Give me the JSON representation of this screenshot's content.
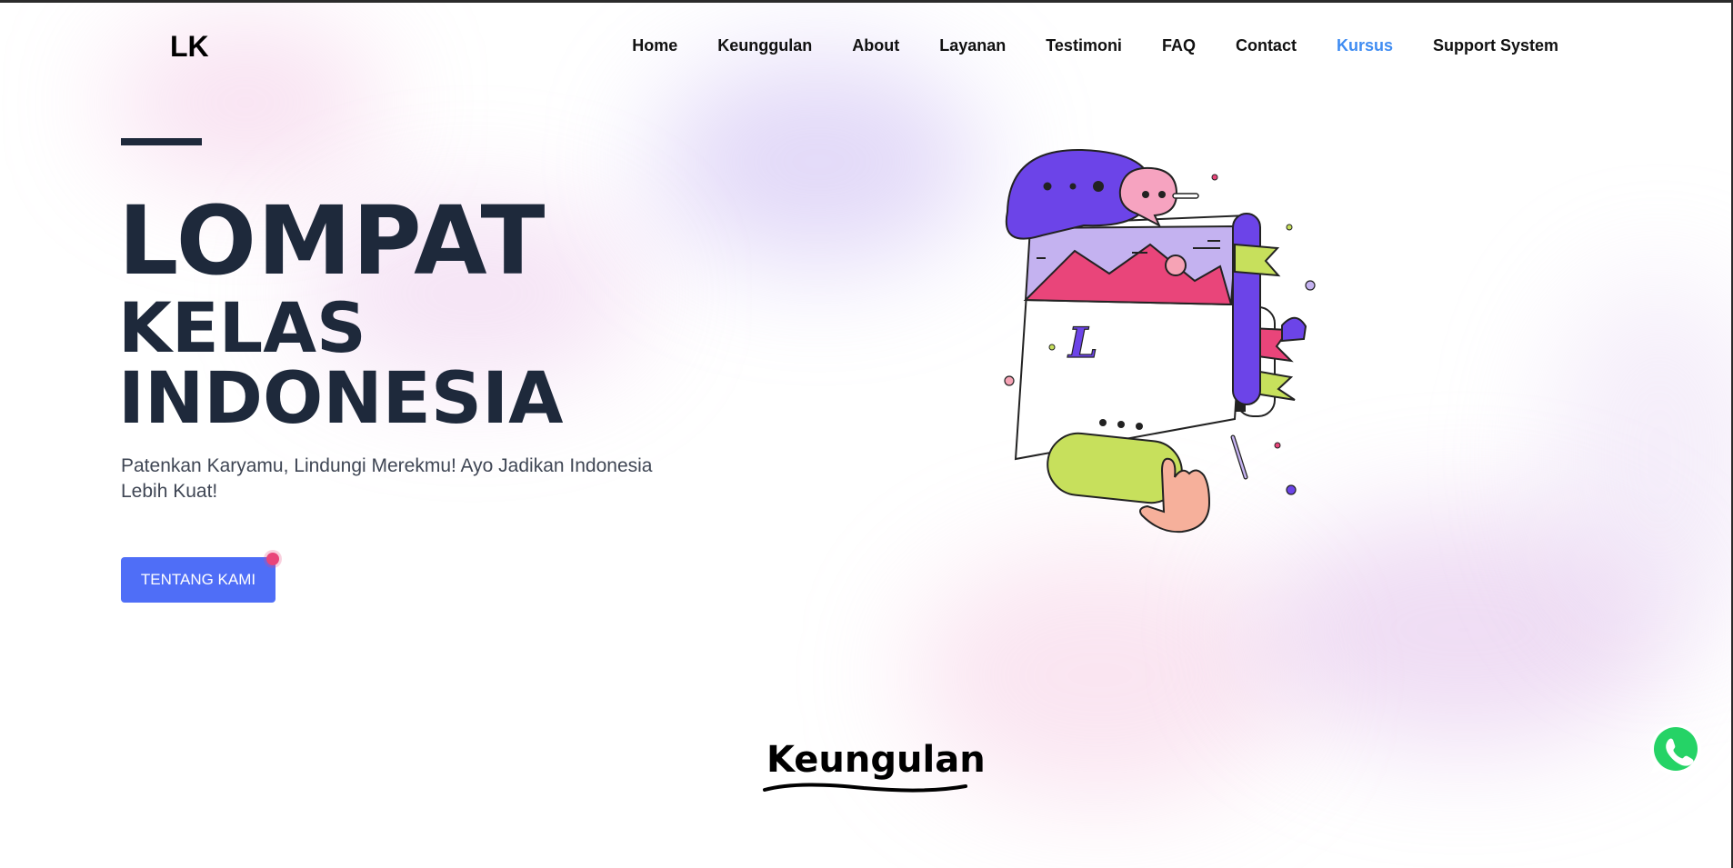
{
  "header": {
    "logo": "LK",
    "nav": [
      {
        "label": "Home"
      },
      {
        "label": "Keunggulan"
      },
      {
        "label": "About"
      },
      {
        "label": "Layanan"
      },
      {
        "label": "Testimoni"
      },
      {
        "label": "FAQ"
      },
      {
        "label": "Contact"
      },
      {
        "label": "Kursus",
        "active": true
      },
      {
        "label": "Support System"
      }
    ]
  },
  "hero": {
    "title_line1": "LOMPAT",
    "title_line2": "KELAS",
    "title_line3": "INDONESIA",
    "subtitle": "Patenkan Karyamu, Lindungi Merekmu! Ayo Jadikan Indonesia Lebih Kuat!",
    "cta_label": "TENTANG KAMI",
    "illustration_letter": "L"
  },
  "section": {
    "title": "Keungulan"
  },
  "colors": {
    "nav_active": "#3f8cf2",
    "cta_bg": "#4f6ef7",
    "heading": "#1e293b",
    "whatsapp": "#25d366"
  },
  "icons": {
    "floating": "whatsapp-icon"
  }
}
